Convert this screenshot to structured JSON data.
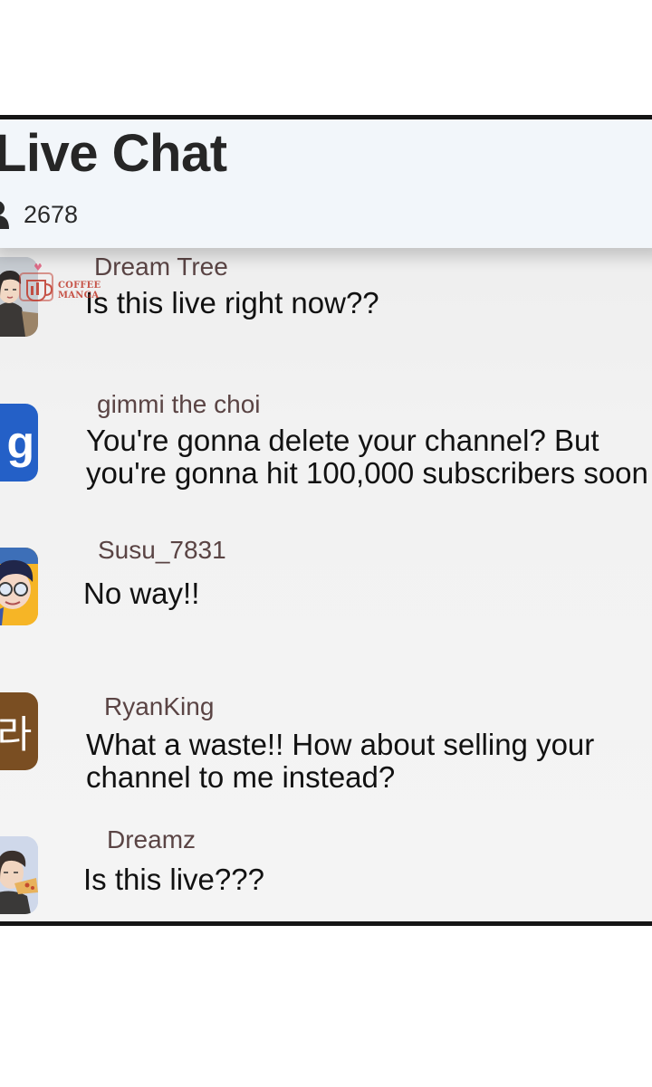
{
  "chat": {
    "title": "Live Chat",
    "viewer_icon": "person-icon",
    "viewer_count": "2678"
  },
  "watermark": {
    "text": "COFFEE MANGA"
  },
  "messages": [
    {
      "username": "Dream Tree",
      "text": "Is this live right now??",
      "avatar": "character-portrait"
    },
    {
      "username": "gimmi the choi",
      "text": "You're gonna delete your channel? But\nyou're gonna hit 100,000 subscribers soon",
      "avatar": "letter-g",
      "avatar_letter": "g",
      "avatar_color": "#2460c7"
    },
    {
      "username": "Susu_7831",
      "text": "No way!!",
      "avatar": "character-portrait"
    },
    {
      "username": "RyanKing",
      "text": "What a waste!! How about selling your\nchannel to me instead?",
      "avatar": "korean-letter",
      "avatar_letter": "라",
      "avatar_color": "#7a4e22"
    },
    {
      "username": "Dreamz",
      "text": "Is this live???",
      "avatar": "character-portrait"
    }
  ]
}
